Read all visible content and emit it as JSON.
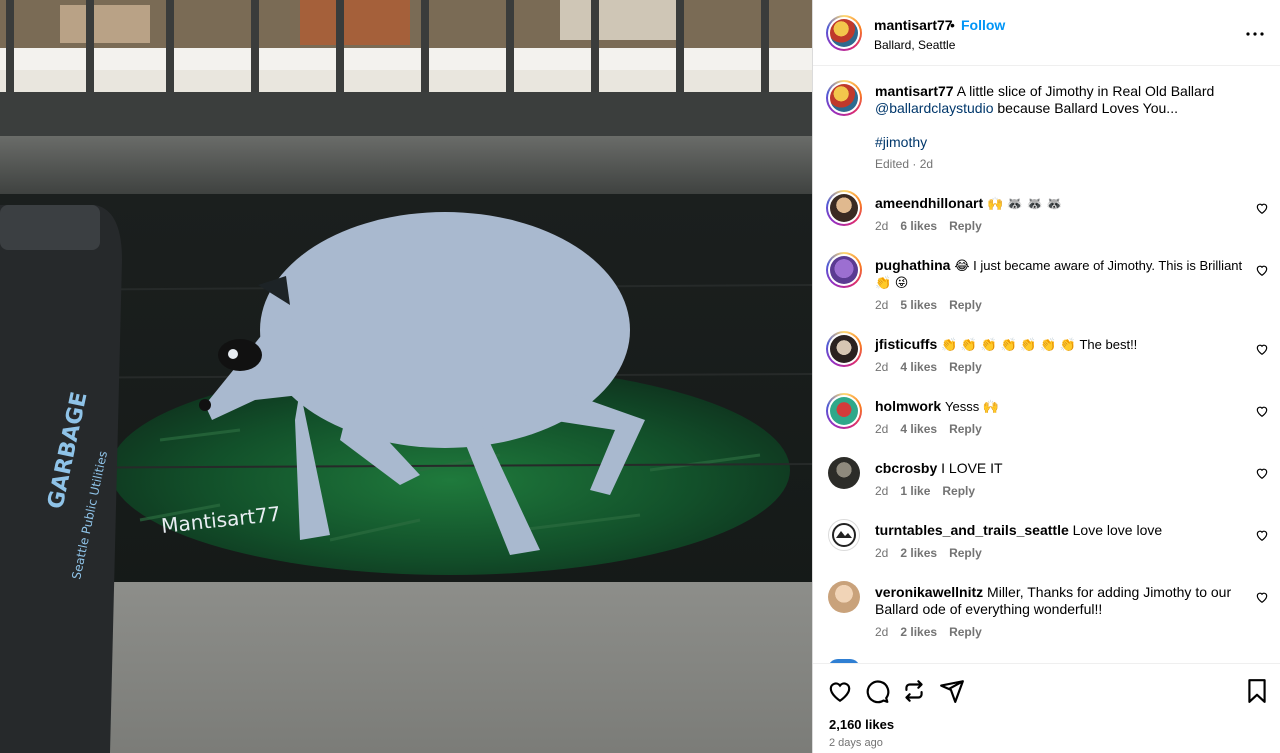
{
  "post": {
    "username": "mantisart77",
    "dot": "•",
    "follow_label": "Follow",
    "location": "Ballard, Seattle",
    "more_icon": "more-options-icon"
  },
  "media": {
    "mural_signature": "Mantisart77",
    "bin_text": "GARBAGE",
    "bin_subtext": "Seattle Public Utilities"
  },
  "caption": {
    "username": "mantisart77",
    "text_line1": "A little slice of Jimothy in Real Old Ballard",
    "mention": "@ballardclaystudio",
    "text_line2": "because Ballard Loves You...",
    "hashtag": "#jimothy",
    "edited": "Edited · 2d"
  },
  "comments": [
    {
      "username": "ameendhillonart",
      "text": "🙌 🦝 🦝 🦝",
      "age": "2d",
      "likes": "6 likes",
      "reply": "Reply"
    },
    {
      "username": "pughathina",
      "text": "😂 I just became aware of Jimothy. This is Brilliant 👏 😜",
      "age": "2d",
      "likes": "5 likes",
      "reply": "Reply"
    },
    {
      "username": "jfisticuffs",
      "text": "👏 👏 👏 👏 👏 👏 👏 The best!!",
      "age": "2d",
      "likes": "4 likes",
      "reply": "Reply"
    },
    {
      "username": "holmwork",
      "text": "Yesss 🙌",
      "age": "2d",
      "likes": "4 likes",
      "reply": "Reply"
    },
    {
      "username": "cbcrosby",
      "text": "I LOVE IT",
      "age": "2d",
      "likes": "1 like",
      "reply": "Reply"
    },
    {
      "username": "turntables_and_trails_seattle",
      "text": "Love love love",
      "age": "2d",
      "likes": "2 likes",
      "reply": "Reply"
    },
    {
      "username": "veronikawellnitz",
      "text": "Miller, Thanks for adding Jimothy to our Ballard ode of everything wonderful!!",
      "age": "2d",
      "likes": "2 likes",
      "reply": "Reply"
    }
  ],
  "actions": {
    "like_icon": "heart-icon",
    "comment_icon": "comment-icon",
    "share_icon": "repost-icon",
    "send_icon": "send-icon",
    "save_icon": "bookmark-icon",
    "likes_count": "2,160 likes",
    "posted": "2 days ago"
  },
  "colors": {
    "link": "#00376b",
    "follow": "#0095f6",
    "muted": "#737373"
  }
}
